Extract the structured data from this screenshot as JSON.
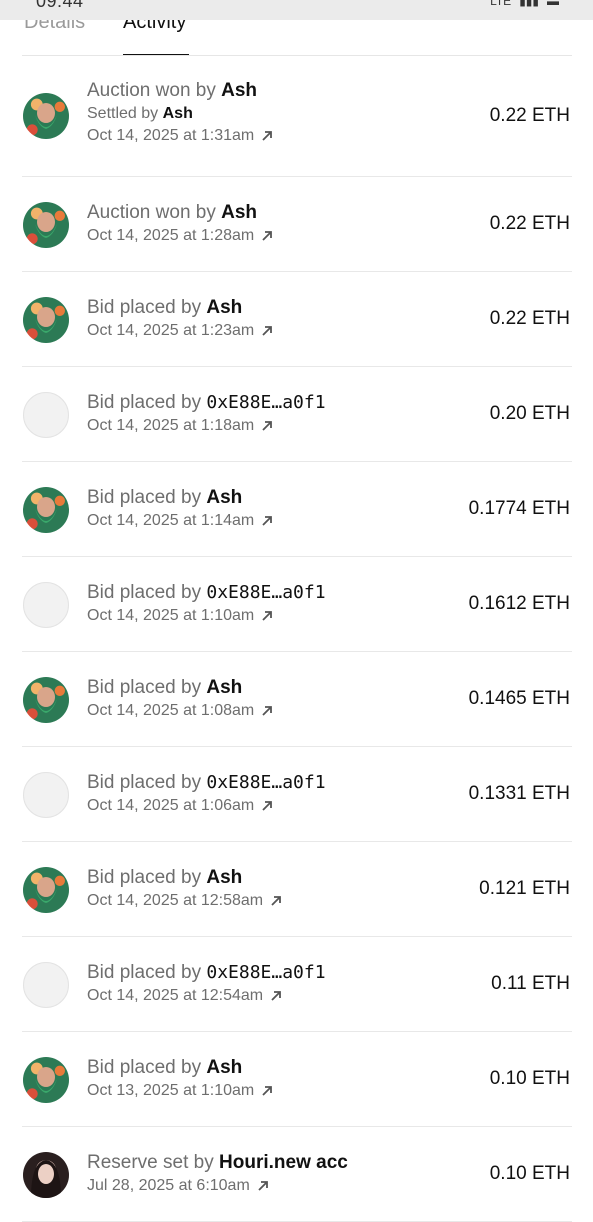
{
  "status_bar": {
    "time": "09:44",
    "network": "LTE"
  },
  "tabs": [
    {
      "label": "Details",
      "active": false
    },
    {
      "label": "Activity",
      "active": true
    }
  ],
  "activity": [
    {
      "action": "Auction won by",
      "actor": "Ash",
      "sub_label": "Settled by",
      "sub_actor": "Ash",
      "date": "Oct 14, 2025 at 1:31am",
      "amount": "0.22 ETH",
      "avatar": "ash"
    },
    {
      "action": "Auction won by",
      "actor": "Ash",
      "date": "Oct 14, 2025 at 1:28am",
      "amount": "0.22 ETH",
      "avatar": "ash"
    },
    {
      "action": "Bid placed by",
      "actor": "Ash",
      "date": "Oct 14, 2025 at 1:23am",
      "amount": "0.22 ETH",
      "avatar": "ash"
    },
    {
      "action": "Bid placed by",
      "actor": "0xE88E…a0f1",
      "date": "Oct 14, 2025 at 1:18am",
      "amount": "0.20 ETH",
      "avatar": "empty"
    },
    {
      "action": "Bid placed by",
      "actor": "Ash",
      "date": "Oct 14, 2025 at 1:14am",
      "amount": "0.1774 ETH",
      "avatar": "ash"
    },
    {
      "action": "Bid placed by",
      "actor": "0xE88E…a0f1",
      "date": "Oct 14, 2025 at 1:10am",
      "amount": "0.1612 ETH",
      "avatar": "empty"
    },
    {
      "action": "Bid placed by",
      "actor": "Ash",
      "date": "Oct 14, 2025 at 1:08am",
      "amount": "0.1465 ETH",
      "avatar": "ash"
    },
    {
      "action": "Bid placed by",
      "actor": "0xE88E…a0f1",
      "date": "Oct 14, 2025 at 1:06am",
      "amount": "0.1331 ETH",
      "avatar": "empty"
    },
    {
      "action": "Bid placed by",
      "actor": "Ash",
      "date": "Oct 14, 2025 at 12:58am",
      "amount": "0.121 ETH",
      "avatar": "ash"
    },
    {
      "action": "Bid placed by",
      "actor": "0xE88E…a0f1",
      "date": "Oct 14, 2025 at 12:54am",
      "amount": "0.11 ETH",
      "avatar": "empty"
    },
    {
      "action": "Bid placed by",
      "actor": "Ash",
      "date": "Oct 13, 2025 at 1:10am",
      "amount": "0.10 ETH",
      "avatar": "ash"
    },
    {
      "action": "Reserve set by",
      "actor": "Houri.new acc",
      "date": "Jul 28, 2025 at 6:10am",
      "amount": "0.10 ETH",
      "avatar": "houri"
    }
  ]
}
